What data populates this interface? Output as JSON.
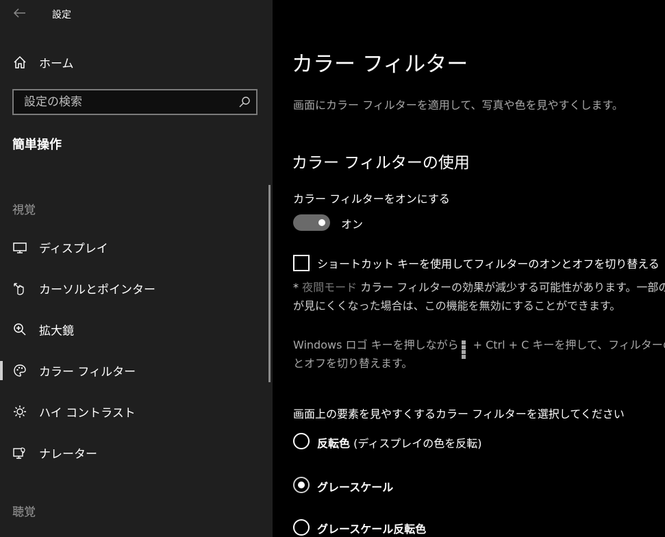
{
  "window": {
    "title": "設定"
  },
  "sidebar": {
    "home_label": "ホーム",
    "search_placeholder": "設定の検索",
    "section_title": "簡単操作",
    "group_vision": "視覚",
    "group_hearing": "聴覚",
    "items": [
      {
        "label": "ディスプレイ",
        "icon": "monitor-icon"
      },
      {
        "label": "カーソルとポインター",
        "icon": "pointer-icon"
      },
      {
        "label": "拡大鏡",
        "icon": "magnifier-icon"
      },
      {
        "label": "カラー フィルター",
        "icon": "palette-icon",
        "selected": true
      },
      {
        "label": "ハイ コントラスト",
        "icon": "sun-icon"
      },
      {
        "label": "ナレーター",
        "icon": "narrator-icon"
      }
    ]
  },
  "main": {
    "title": "カラー フィルター",
    "description": "画面にカラー フィルターを適用して、写真や色を見やすくします。",
    "section_title": "カラー フィルターの使用",
    "toggle_label": "カラー フィルターをオンにする",
    "toggle_state": "オン",
    "toggle_on": true,
    "checkbox_label": "ショートカット キーを使用してフィルターのオンとオフを切り替える",
    "checkbox_checked": false,
    "note_prefix": "* ",
    "note_link": "夜間モード",
    "note_line1_rest": " カラー フィルターの効果が減少する可能性があります。一部の",
    "note_line2": "が見にくくなった場合は、この機能を無効にすることができます。",
    "info_line1_a": "Windows ロゴ キーを押しながら",
    "info_line1_b": "+ Ctrl + C キーを押して、フィルターのオン",
    "info_line2": "とオフを切り替えます。",
    "radio_prompt": "画面上の要素を見やすくするカラー フィルターを選択してください",
    "radios": [
      {
        "label_bold": "反転色",
        "label_rest": " (ディスプレイの色を反転)",
        "selected": false
      },
      {
        "label_bold": "グレースケール",
        "label_rest": "",
        "selected": true
      },
      {
        "label_bold": "グレースケール反転色",
        "label_rest": "",
        "selected": false
      }
    ]
  },
  "colors": {
    "sidebar_bg": "#1f1f1f",
    "main_bg": "#000000",
    "toggle_track": "#6a6a6a"
  }
}
